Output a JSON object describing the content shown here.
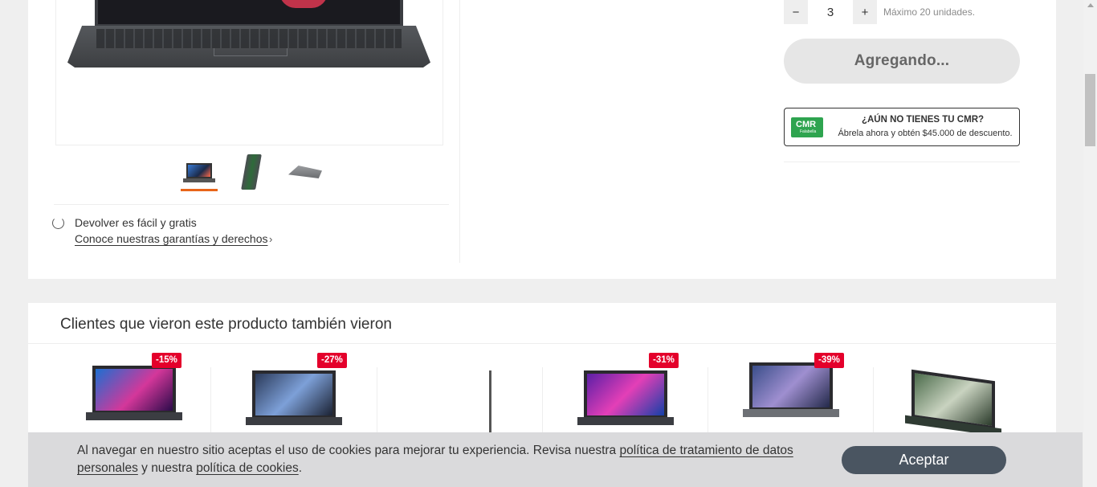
{
  "colors": {
    "accent": "#e8651a",
    "badge": "#e4002b",
    "cmr_green": "#2ea44f",
    "accept_button": "#4a5561"
  },
  "gallery": {
    "thumbnails": [
      "laptop-front",
      "laptop-side",
      "laptop-closed"
    ],
    "active_index": 0
  },
  "returns": {
    "text": "Devolver es fácil y gratis",
    "link": "Conoce nuestras garantías y derechos"
  },
  "quantity": {
    "decrement": "−",
    "value": "3",
    "increment": "+",
    "max_text": "Máximo 20 unidades."
  },
  "add_button": {
    "label": "Agregando..."
  },
  "cmr": {
    "logo_big": "CMR",
    "logo_small": "Falabella",
    "title": "¿AÚN NO TIENES TU CMR?",
    "subtitle": "Ábrela ahora y obtén $45.000 de descuento."
  },
  "recommendations": {
    "title": "Clientes que vieron este producto también vieron",
    "items": [
      {
        "badge": "-15%"
      },
      {
        "badge": "-27%"
      },
      {
        "badge": ""
      },
      {
        "badge": "-31%"
      },
      {
        "badge": "-39%"
      },
      {
        "badge": ""
      }
    ]
  },
  "cookie": {
    "text_before": "Al navegar en nuestro sitio aceptas el uso de cookies para mejorar tu experiencia. Revisa nuestra ",
    "link1": "política de tratamiento de datos personales",
    "text_mid": " y nuestra ",
    "link2": "política de cookies",
    "text_end": ".",
    "accept": "Aceptar"
  }
}
